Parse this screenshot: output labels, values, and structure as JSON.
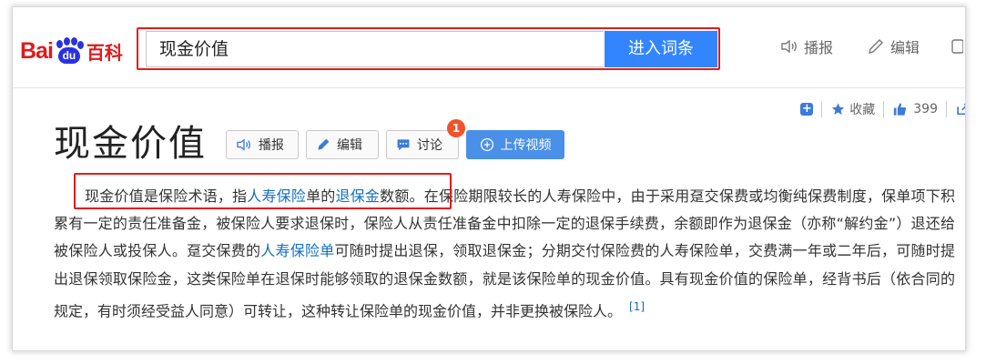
{
  "header": {
    "logo_left": "Bai",
    "logo_pad": "du",
    "logo_right": "百科",
    "search_value": "现金价值",
    "search_button": "进入词条",
    "actions": [
      {
        "label": "播报",
        "icon": "speaker-icon"
      },
      {
        "label": "编辑",
        "icon": "pencil-icon"
      }
    ]
  },
  "tools": {
    "collect_label": "收藏",
    "like_count": "399"
  },
  "entry": {
    "title": "现金价值",
    "buttons": {
      "broadcast": "播报",
      "edit": "编辑",
      "discuss": "讨论",
      "upload_video": "上传视频"
    },
    "discuss_badge": "1"
  },
  "paragraph": {
    "s1": "现金价值是保险术语，指",
    "link1": "人寿保险",
    "s2": "单的",
    "link2": "退保金",
    "s3": "数额。在保险期限较长的人寿保险中，由于采用趸交保费或均衡纯保费制度，保单项下积累有一定的责任准备金，被保险人要求退保时，保险人从责任准备金中扣除一定的退保手续费，余额即作为退保金（亦称“解约金”）退还给被保险人或投保人。趸交保费的",
    "link3": "人寿保险单",
    "s4": "可随时提出退保，领取退保金；分期交付保险费的人寿保险单，交费满一年或二年后，可随时提出退保领取保险金，这类保险单在退保时能够领取的退保金数额，就是该保险单的现金价值。具有现金价值的保险单，经背书后（依合同的规定，有时须经受益人同意）可转让，这种转让保险单的现金价值，并非更换被保险人。",
    "ref": "[1]"
  },
  "colors": {
    "accent": "#3385ff",
    "link": "#136ec2",
    "logo_red": "#de1a1d",
    "logo_blue": "#2932e1",
    "annotation_red": "#e51b1b",
    "badge": "#f0532c"
  }
}
